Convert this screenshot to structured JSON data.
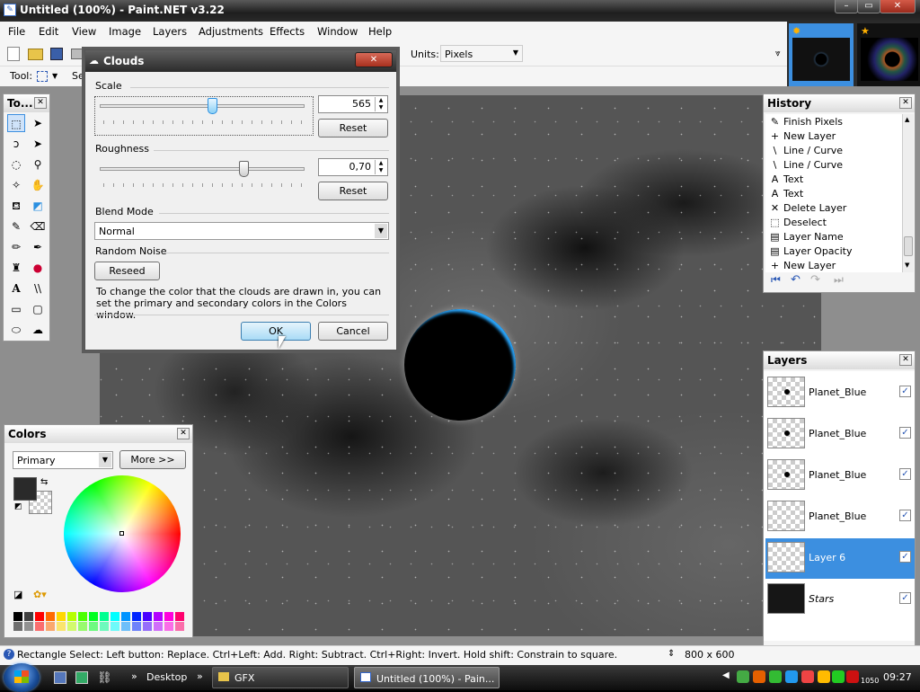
{
  "window": {
    "title": "Untitled (100%) - Paint.NET v3.22",
    "minimize": "–",
    "maximize": "▭",
    "close": "✕"
  },
  "menu": [
    "File",
    "Edit",
    "View",
    "Image",
    "Layers",
    "Adjustments",
    "Effects",
    "Window",
    "Help"
  ],
  "toolbar": {
    "units_label": "Units:",
    "units_value": "Pixels"
  },
  "toolbar2": {
    "tool_label": "Tool:",
    "sel_label": "Se"
  },
  "tools_panel": {
    "title": "To..."
  },
  "history": {
    "title": "History",
    "items": [
      {
        "icon": "pencil-icon",
        "glyph": "✎",
        "label": "Finish Pixels"
      },
      {
        "icon": "new-layer-icon",
        "glyph": "+",
        "label": "New Layer"
      },
      {
        "icon": "line-curve-icon",
        "glyph": "\\",
        "label": "Line / Curve"
      },
      {
        "icon": "line-curve-icon",
        "glyph": "\\",
        "label": "Line / Curve"
      },
      {
        "icon": "text-icon",
        "glyph": "A",
        "label": "Text"
      },
      {
        "icon": "text-icon",
        "glyph": "A",
        "label": "Text"
      },
      {
        "icon": "delete-icon",
        "glyph": "✕",
        "label": "Delete Layer"
      },
      {
        "icon": "deselect-icon",
        "glyph": "⬚",
        "label": "Deselect"
      },
      {
        "icon": "layer-properties-icon",
        "glyph": "▤",
        "label": "Layer Name"
      },
      {
        "icon": "layer-properties-icon",
        "glyph": "▤",
        "label": "Layer Opacity"
      },
      {
        "icon": "new-layer-icon",
        "glyph": "+",
        "label": "New Layer"
      }
    ]
  },
  "layers": {
    "title": "Layers",
    "items": [
      {
        "name": "Planet_Blue",
        "visible": "✓",
        "selected": false,
        "thumb": "planet"
      },
      {
        "name": "Planet_Blue",
        "visible": "✓",
        "selected": false,
        "thumb": "planet"
      },
      {
        "name": "Planet_Blue",
        "visible": "✓",
        "selected": false,
        "thumb": "planet"
      },
      {
        "name": "Planet_Blue",
        "visible": "✓",
        "selected": false,
        "thumb": "empty"
      },
      {
        "name": "Layer 6",
        "visible": "✓",
        "selected": true,
        "thumb": "empty"
      },
      {
        "name": "Stars",
        "visible": "✓",
        "selected": false,
        "thumb": "dark"
      }
    ]
  },
  "colors": {
    "title": "Colors",
    "mode": "Primary",
    "more_button": "More >>",
    "primary": "#2a2a2a",
    "palette": [
      "#000000",
      "#404040",
      "#ff0000",
      "#ff6a00",
      "#ffd800",
      "#b6ff00",
      "#4cff00",
      "#00ff21",
      "#00ff90",
      "#00ffff",
      "#0094ff",
      "#0026ff",
      "#4800ff",
      "#b200ff",
      "#ff00dc",
      "#ff006e"
    ]
  },
  "dialog": {
    "title": "Clouds",
    "scale_label": "Scale",
    "scale_value": "565",
    "scale_fraction": 0.55,
    "reset1": "Reset",
    "roughness_label": "Roughness",
    "roughness_value": "0,70",
    "roughness_fraction": 0.7,
    "reset2": "Reset",
    "blend_label": "Blend Mode",
    "blend_value": "Normal",
    "noise_label": "Random Noise",
    "reseed": "Reseed",
    "hint": "To change the color that the clouds are drawn in, you can set the primary and secondary colors in the Colors window.",
    "ok": "OK",
    "cancel": "Cancel"
  },
  "status": {
    "text": "Rectangle Select: Left button: Replace. Ctrl+Left: Add. Right: Subtract. Ctrl+Right: Invert. Hold shift: Constrain to square.",
    "size": "800 x 600"
  },
  "taskbar": {
    "desktop": "Desktop",
    "folder": "GFX",
    "app": "Untitled (100%) - Pain...",
    "clock": "09:27",
    "tray_num": "1050"
  },
  "accent": "#3c8fe0"
}
